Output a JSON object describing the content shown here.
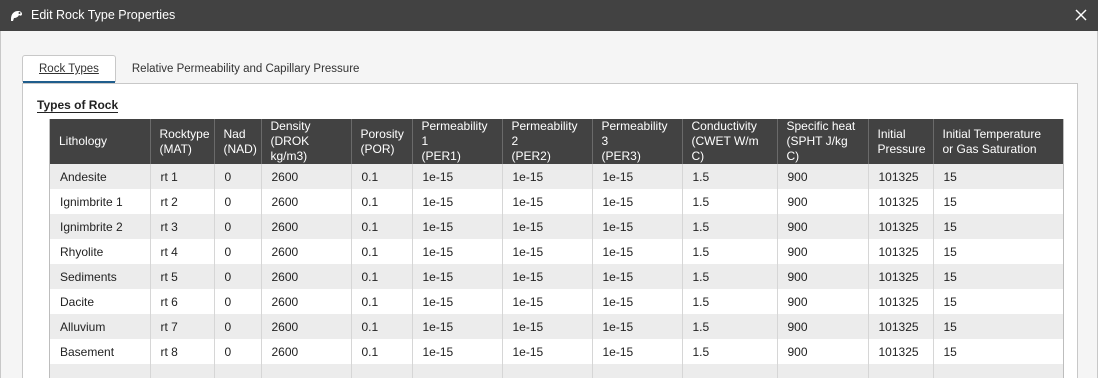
{
  "window": {
    "title": "Edit Rock Type Properties",
    "close_icon": "close-icon",
    "app_icon": "leapfrog-icon"
  },
  "tabs": [
    {
      "label": "Rock Types",
      "active": true
    },
    {
      "label": "Relative Permeability and Capillary Pressure",
      "active": false
    }
  ],
  "group": {
    "title": "Types of Rock"
  },
  "table": {
    "headers": [
      {
        "line1": "Lithology",
        "line2": ""
      },
      {
        "line1": "Rocktype",
        "line2": "(MAT)"
      },
      {
        "line1": "Nad",
        "line2": "(NAD)"
      },
      {
        "line1": "Density",
        "line2": "(DROK kg/m3)"
      },
      {
        "line1": "Porosity",
        "line2": "(POR)"
      },
      {
        "line1": "Permeability 1",
        "line2": "(PER1)"
      },
      {
        "line1": "Permeability 2",
        "line2": "(PER2)"
      },
      {
        "line1": "Permeability 3",
        "line2": "(PER3)"
      },
      {
        "line1": "Conductivity",
        "line2": "(CWET W/m C)"
      },
      {
        "line1": "Specific heat",
        "line2": "(SPHT J/kg C)"
      },
      {
        "line1": "Initial",
        "line2": "Pressure"
      },
      {
        "line1": "Initial Temperature",
        "line2": "or Gas Saturation"
      }
    ],
    "rows": [
      [
        "Andesite",
        "rt 1",
        "0",
        "2600",
        "0.1",
        "1e-15",
        "1e-15",
        "1e-15",
        "1.5",
        "900",
        "101325",
        "15"
      ],
      [
        "Ignimbrite 1",
        "rt 2",
        "0",
        "2600",
        "0.1",
        "1e-15",
        "1e-15",
        "1e-15",
        "1.5",
        "900",
        "101325",
        "15"
      ],
      [
        "Ignimbrite 2",
        "rt 3",
        "0",
        "2600",
        "0.1",
        "1e-15",
        "1e-15",
        "1e-15",
        "1.5",
        "900",
        "101325",
        "15"
      ],
      [
        "Rhyolite",
        "rt 4",
        "0",
        "2600",
        "0.1",
        "1e-15",
        "1e-15",
        "1e-15",
        "1.5",
        "900",
        "101325",
        "15"
      ],
      [
        "Sediments",
        "rt 5",
        "0",
        "2600",
        "0.1",
        "1e-15",
        "1e-15",
        "1e-15",
        "1.5",
        "900",
        "101325",
        "15"
      ],
      [
        "Dacite",
        "rt 6",
        "0",
        "2600",
        "0.1",
        "1e-15",
        "1e-15",
        "1e-15",
        "1.5",
        "900",
        "101325",
        "15"
      ],
      [
        "Alluvium",
        "rt 7",
        "0",
        "2600",
        "0.1",
        "1e-15",
        "1e-15",
        "1e-15",
        "1.5",
        "900",
        "101325",
        "15"
      ],
      [
        "Basement",
        "rt 8",
        "0",
        "2600",
        "0.1",
        "1e-15",
        "1e-15",
        "1e-15",
        "1.5",
        "900",
        "101325",
        "15"
      ]
    ]
  },
  "colors": {
    "titlebar": "#424242",
    "header_bg": "#424242",
    "accent": "#1f5d8c"
  }
}
